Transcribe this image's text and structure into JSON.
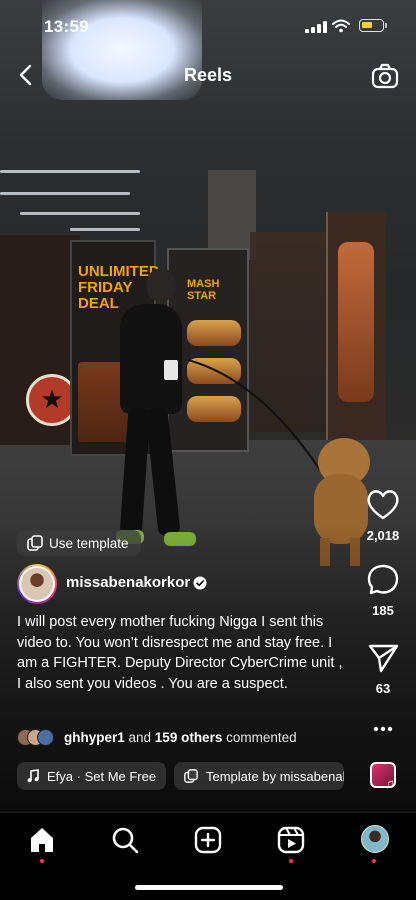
{
  "status_bar": {
    "time": "13:59"
  },
  "header": {
    "title": "Reels"
  },
  "actions": {
    "likes": "2,018",
    "comments": "185",
    "shares": "63"
  },
  "use_template_label": "Use template",
  "post": {
    "username": "missabenakorkor",
    "caption": "I will post every mother fucking Nigga I sent this video to. You won’t disrespect me and stay free. I am a FIGHTER. Deputy Director CyberCrime unit , I also sent you videos . You are a suspect."
  },
  "comments_summary": {
    "first_user": "ghhyper1",
    "middle": " and ",
    "others": "159 others",
    "suffix": " commented"
  },
  "audio": {
    "track": "Efya · Set Me Free",
    "template": "Template by missabenakorkor"
  },
  "scene_signage": {
    "banner_text": "UNLIMITED FRIDAY DEAL",
    "banner2_text": "MASH STAR"
  },
  "colors": {
    "notification_dot": "#ff3040",
    "verified": "#ffffff",
    "battery": "#f4d03f"
  }
}
